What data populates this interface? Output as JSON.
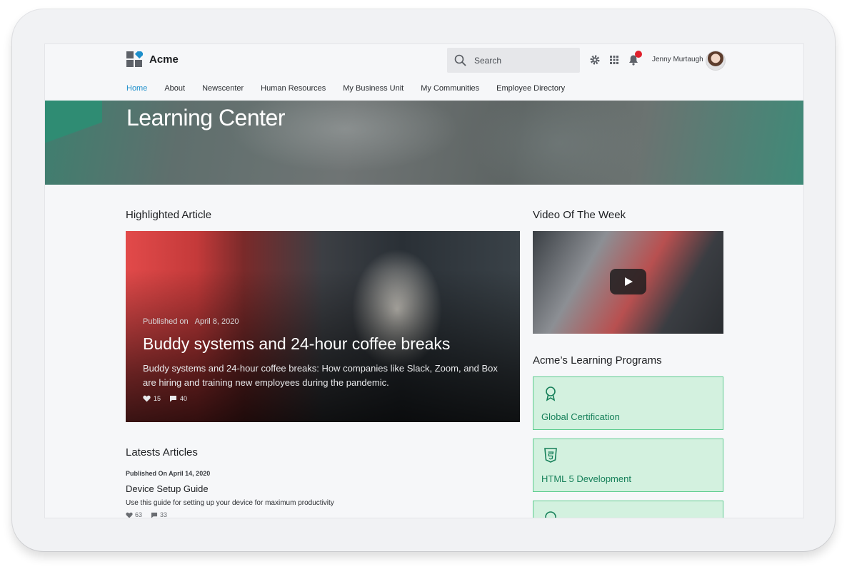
{
  "brand": {
    "name": "Acme",
    "colors": {
      "blue": "#1e8fcb",
      "green": "#5dcc8f",
      "green_text": "#17805a",
      "alert": "#e0202c"
    }
  },
  "header": {
    "search_placeholder": "Search",
    "icons": [
      "search-icon",
      "gear-icon",
      "apps-grid-icon",
      "bell-icon"
    ],
    "user_name": "Jenny Murtaugh"
  },
  "nav": {
    "items": [
      "Home",
      "About",
      "Newscenter",
      "Human Resources",
      "My Business Unit",
      "My Communities",
      "Employee Directory"
    ],
    "active": "Home"
  },
  "hero": {
    "title": "Learning Center"
  },
  "highlighted": {
    "section_title": "Highlighted Article",
    "published_label": "Published on",
    "date": "April 8, 2020",
    "title": "Buddy systems and 24-hour coffee breaks",
    "description": "Buddy systems and 24-hour coffee breaks: How companies like Slack, Zoom, and Box are hiring and training new employees during the pandemic.",
    "likes": "15",
    "comments": "40"
  },
  "video": {
    "section_title": "Video Of The Week"
  },
  "programs": {
    "section_title": "Acme’s Learning Programs",
    "items": [
      {
        "label": "Global Certification",
        "icon": "award-icon"
      },
      {
        "label": "HTML 5 Development",
        "icon": "html5-icon"
      },
      {
        "label": "",
        "icon": "headset-icon"
      }
    ]
  },
  "latest": {
    "section_title": "Latests Articles",
    "items": [
      {
        "published": "Published  On April 14, 2020",
        "title": "Device Setup Guide",
        "description": "Use this guide for setting up your device for maximum productivity",
        "likes": "63",
        "comments": "33"
      }
    ]
  }
}
